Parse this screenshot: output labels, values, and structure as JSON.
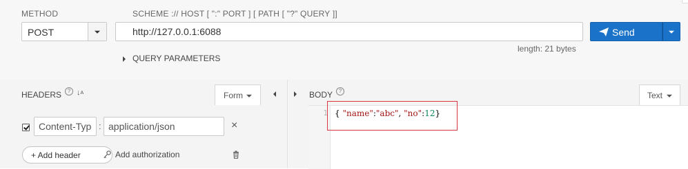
{
  "request": {
    "method_label": "METHOD",
    "method_value": "POST",
    "url_label": "SCHEME :// HOST [ \":\" PORT ] [ PATH [ \"?\" QUERY ]]",
    "url_value": "http://127.0.0.1:6088",
    "length_text": "length: 21 bytes",
    "send_label": "Send",
    "query_params_label": "QUERY PARAMETERS"
  },
  "headers_panel": {
    "title": "HEADERS",
    "help": "?",
    "sort_glyph": "↓",
    "form_label": "Form",
    "rows": [
      {
        "enabled": true,
        "name": "Content-Type",
        "separator": ":",
        "value": "application/json",
        "remove": "×"
      }
    ],
    "add_header_label": "+ Add header",
    "add_auth_label": "Add authorization"
  },
  "body_panel": {
    "title": "BODY",
    "help": "?",
    "mode_label": "Text",
    "line_number": "1",
    "code": {
      "open": "{ ",
      "k1": "\"name\"",
      "colon1": ":",
      "v1": "\"abc\"",
      "comma": ", ",
      "k2": "\"no\"",
      "colon2": ":",
      "v2": "12",
      "close": "}"
    }
  },
  "colors": {
    "accent": "#1a73c8",
    "highlight": "#d9363e",
    "string": "#a31515",
    "number": "#098658"
  },
  "icons": [
    "chevron-down-icon",
    "paper-plane-icon",
    "caret-right-icon",
    "caret-left-icon",
    "help-icon",
    "sort-icon",
    "close-icon",
    "key-icon",
    "trash-icon"
  ]
}
